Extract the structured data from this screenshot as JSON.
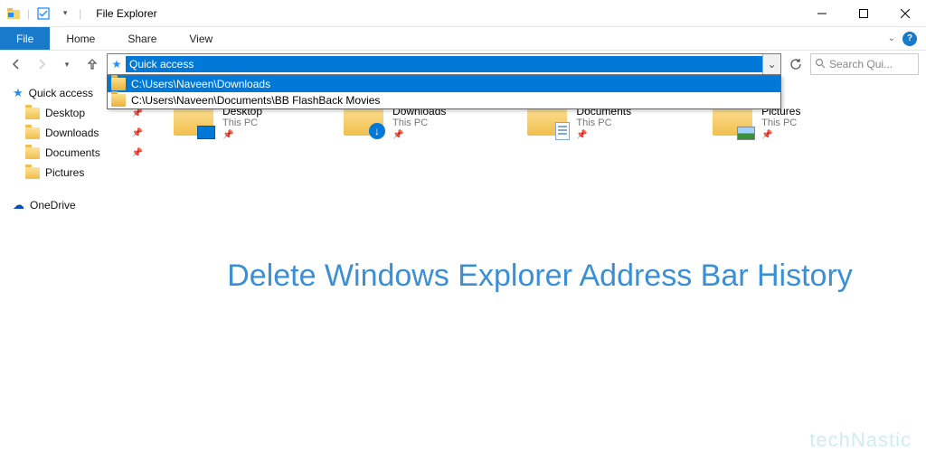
{
  "window": {
    "title": "File Explorer"
  },
  "ribbon": {
    "file": "File",
    "tabs": [
      "Home",
      "Share",
      "View"
    ]
  },
  "nav": {
    "address_value": "Quick access",
    "search_placeholder": "Search Qui...",
    "history": [
      {
        "path": "C:\\Users\\Naveen\\Downloads",
        "selected": true
      },
      {
        "path": "C:\\Users\\Naveen\\Documents\\BB FlashBack Movies",
        "selected": false
      }
    ]
  },
  "sidebar": {
    "quick_access": "Quick access",
    "items": [
      {
        "label": "Desktop",
        "pinned": true
      },
      {
        "label": "Downloads",
        "pinned": true
      },
      {
        "label": "Documents",
        "pinned": true
      },
      {
        "label": "Pictures",
        "pinned": false
      }
    ],
    "onedrive": "OneDrive"
  },
  "content": {
    "tiles": [
      {
        "name": "Desktop",
        "sub": "This PC",
        "overlay": "blue"
      },
      {
        "name": "Downloads",
        "sub": "This PC",
        "overlay": "arrow"
      },
      {
        "name": "Documents",
        "sub": "This PC",
        "overlay": "doc"
      },
      {
        "name": "Pictures",
        "sub": "This PC",
        "overlay": "pic"
      }
    ]
  },
  "banner": "Delete Windows Explorer Address Bar History",
  "watermark": "techNastic"
}
